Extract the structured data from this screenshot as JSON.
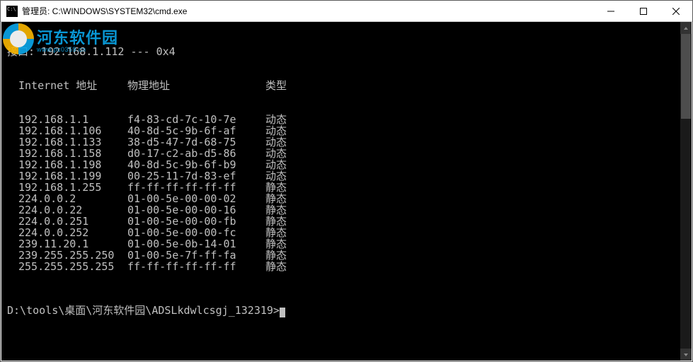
{
  "window": {
    "title": "管理员: C:\\WINDOWS\\SYSTEM32\\cmd.exe"
  },
  "watermark": {
    "main": "河东软件园",
    "sub": "www.pc0359.cn"
  },
  "terminal": {
    "interface_line": "接口: 192.168.1.112 --- 0x4",
    "header": {
      "col1": "Internet 地址",
      "col2": "物理地址",
      "col3": "类型"
    },
    "rows": [
      {
        "ip": "192.168.1.1",
        "mac": "f4-83-cd-7c-10-7e",
        "type": "动态"
      },
      {
        "ip": "192.168.1.106",
        "mac": "40-8d-5c-9b-6f-af",
        "type": "动态"
      },
      {
        "ip": "192.168.1.133",
        "mac": "38-d5-47-7d-68-75",
        "type": "动态"
      },
      {
        "ip": "192.168.1.158",
        "mac": "d0-17-c2-ab-d5-86",
        "type": "动态"
      },
      {
        "ip": "192.168.1.198",
        "mac": "40-8d-5c-9b-6f-b9",
        "type": "动态"
      },
      {
        "ip": "192.168.1.199",
        "mac": "00-25-11-7d-83-ef",
        "type": "动态"
      },
      {
        "ip": "192.168.1.255",
        "mac": "ff-ff-ff-ff-ff-ff",
        "type": "静态"
      },
      {
        "ip": "224.0.0.2",
        "mac": "01-00-5e-00-00-02",
        "type": "静态"
      },
      {
        "ip": "224.0.0.22",
        "mac": "01-00-5e-00-00-16",
        "type": "静态"
      },
      {
        "ip": "224.0.0.251",
        "mac": "01-00-5e-00-00-fb",
        "type": "静态"
      },
      {
        "ip": "224.0.0.252",
        "mac": "01-00-5e-00-00-fc",
        "type": "静态"
      },
      {
        "ip": "239.11.20.1",
        "mac": "01-00-5e-0b-14-01",
        "type": "静态"
      },
      {
        "ip": "239.255.255.250",
        "mac": "01-00-5e-7f-ff-fa",
        "type": "静态"
      },
      {
        "ip": "255.255.255.255",
        "mac": "ff-ff-ff-ff-ff-ff",
        "type": "静态"
      }
    ],
    "prompt": "D:\\tools\\桌面\\河东软件园\\ADSLkdwlcsgj_132319>"
  }
}
